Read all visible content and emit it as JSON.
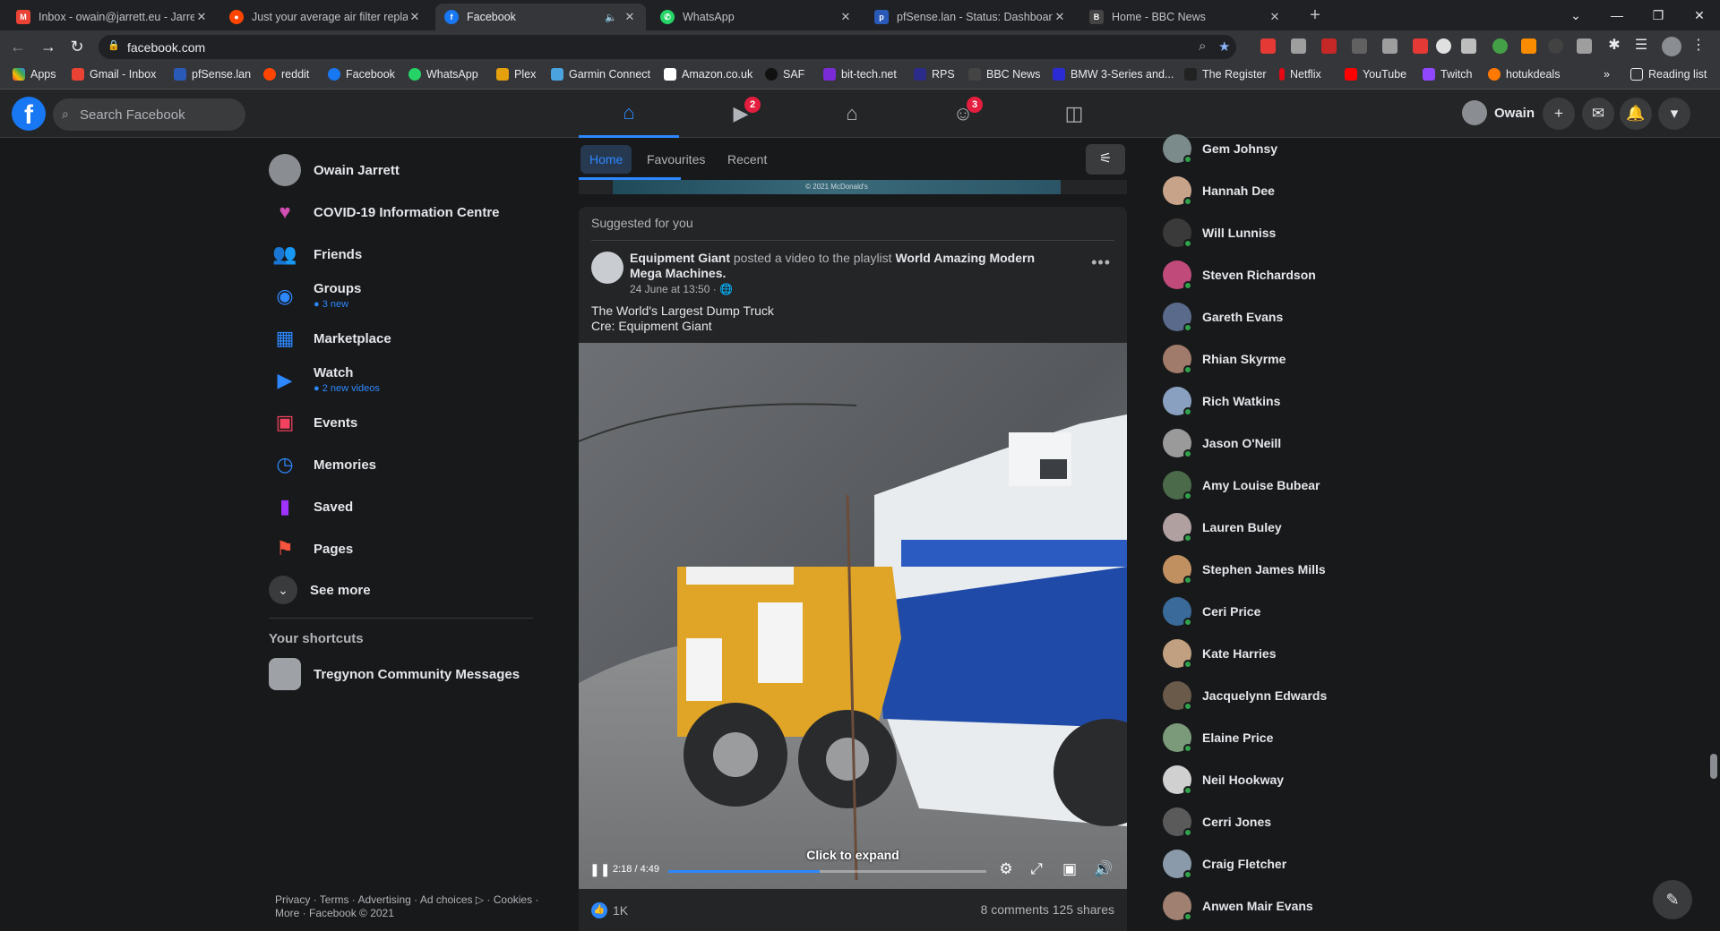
{
  "browser": {
    "tabs": [
      {
        "title": "Inbox - owain@jarrett.eu - Jarrett",
        "icon": "gmail-icon",
        "color": "#ea4335"
      },
      {
        "title": "Just your average air filter replac",
        "icon": "reddit-icon",
        "color": "#ff4500"
      },
      {
        "title": "Facebook",
        "icon": "facebook-icon",
        "color": "#1877f2"
      },
      {
        "title": "WhatsApp",
        "icon": "whatsapp-icon",
        "color": "#25d366"
      },
      {
        "title": "pfSense.lan - Status: Dashboard",
        "icon": "pfsense-icon",
        "color": "#2a5ab8"
      },
      {
        "title": "Home - BBC News",
        "icon": "bbc-icon",
        "color": "#444444"
      }
    ],
    "url": "facebook.com",
    "bookmarks": [
      {
        "label": "Apps",
        "color": "#ea4335"
      },
      {
        "label": "Gmail - Inbox",
        "color": "#ea4335"
      },
      {
        "label": "pfSense.lan",
        "color": "#2a5ab8"
      },
      {
        "label": "reddit",
        "color": "#ff4500"
      },
      {
        "label": "Facebook",
        "color": "#1877f2"
      },
      {
        "label": "WhatsApp",
        "color": "#25d366"
      },
      {
        "label": "Plex",
        "color": "#e5a00d"
      },
      {
        "label": "Garmin Connect",
        "color": "#4aa3df"
      },
      {
        "label": "Amazon.co.uk",
        "color": "#ffffff"
      },
      {
        "label": "SAF",
        "color": "#222222"
      },
      {
        "label": "bit-tech.net",
        "color": "#7a2bd6"
      },
      {
        "label": "RPS",
        "color": "#2b2b8a"
      },
      {
        "label": "BBC News",
        "color": "#444444"
      },
      {
        "label": "BMW 3-Series and...",
        "color": "#2b2bd6"
      },
      {
        "label": "The Register",
        "color": "#222222"
      },
      {
        "label": "Netflix",
        "color": "#e50914"
      },
      {
        "label": "YouTube",
        "color": "#ff0000"
      },
      {
        "label": "Twitch",
        "color": "#9146ff"
      },
      {
        "label": "hotukdeals",
        "color": "#ff7900"
      }
    ],
    "overflow": "»",
    "reading_list": "Reading list"
  },
  "fb": {
    "search_placeholder": "Search Facebook",
    "watch_badge": "2",
    "groups_badge": "3",
    "profile_name": "Owain",
    "feed_tabs": [
      "Home",
      "Favourites",
      "Recent"
    ],
    "prev_post_caption": "© 2021 McDonald's",
    "left_nav": [
      {
        "label": "Owain Jarrett",
        "sub": "",
        "icon": "avatar"
      },
      {
        "label": "COVID-19 Information Centre",
        "sub": "",
        "icon": "heart-icon"
      },
      {
        "label": "Friends",
        "sub": "",
        "icon": "friends-icon"
      },
      {
        "label": "Groups",
        "sub": "3 new",
        "icon": "groups-icon"
      },
      {
        "label": "Marketplace",
        "sub": "",
        "icon": "marketplace-icon"
      },
      {
        "label": "Watch",
        "sub": "2 new videos",
        "icon": "watch-icon"
      },
      {
        "label": "Events",
        "sub": "",
        "icon": "events-icon"
      },
      {
        "label": "Memories",
        "sub": "",
        "icon": "memories-icon"
      },
      {
        "label": "Saved",
        "sub": "",
        "icon": "saved-icon"
      },
      {
        "label": "Pages",
        "sub": "",
        "icon": "pages-icon"
      },
      {
        "label": "See more",
        "sub": "",
        "icon": "chevron-down-icon"
      }
    ],
    "shortcuts_heading": "Your shortcuts",
    "shortcut": "Tregynon Community Messages",
    "footer_line1": "Privacy · Terms · Advertising · Ad choices ▷ · Cookies ·",
    "footer_line2": "More · Facebook © 2021",
    "post": {
      "suggested": "Suggested for you",
      "author": "Equipment Giant",
      "action": " posted a video to the playlist ",
      "playlist": "World Amazing Modern Mega Machines.",
      "time": "24 June at 13:50 · 🌐",
      "text1": "The World's Largest Dump Truck",
      "text2": "Cre: Equipment Giant",
      "video_time": "2:18 / 4:49",
      "video_progress": 0.477,
      "expand": "Click to expand",
      "likes": "1K",
      "comments_shares": "8 comments  125 shares"
    },
    "contacts": [
      "Gem Johnsy",
      "Hannah Dee",
      "Will Lunniss",
      "Steven Richardson",
      "Gareth Evans",
      "Rhian Skyrme",
      "Rich Watkins",
      "Jason O'Neill",
      "Amy Louise Bubear",
      "Lauren Buley",
      "Stephen James Mills",
      "Ceri Price",
      "Kate Harries",
      "Jacquelynn Edwards",
      "Elaine Price",
      "Neil Hookway",
      "Cerri Jones",
      "Craig Fletcher",
      "Anwen Mair Evans"
    ]
  }
}
